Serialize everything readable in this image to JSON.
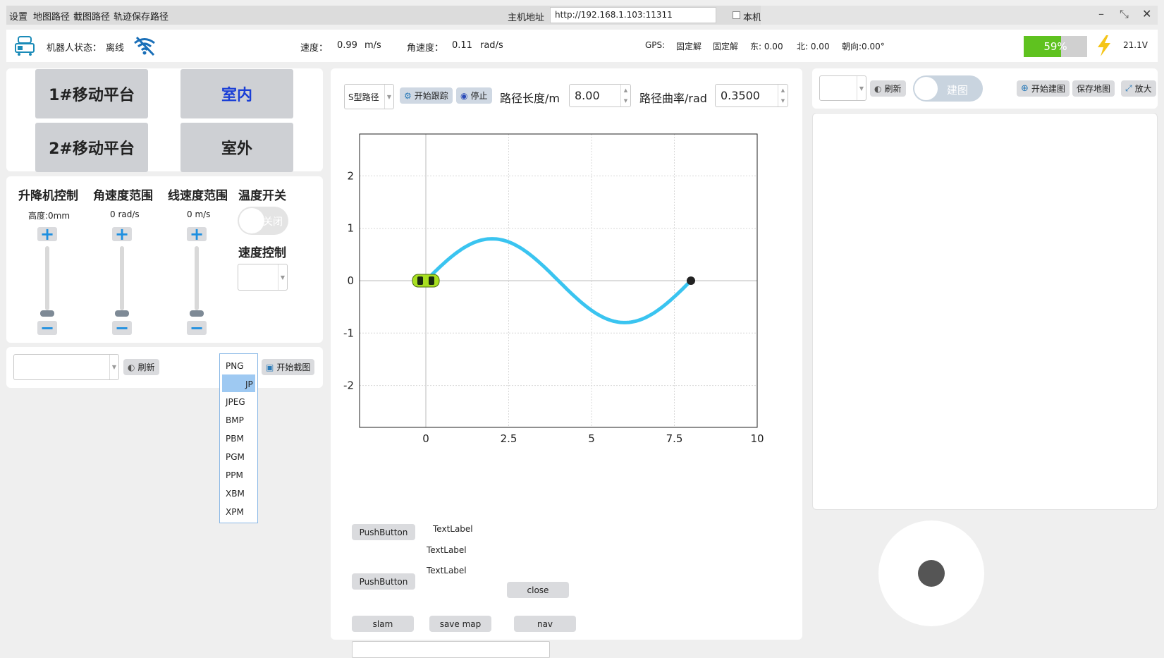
{
  "menu": {
    "items": [
      "设置",
      "地图路径",
      "截图路径",
      "轨迹保存路径"
    ],
    "host_label": "主机地址",
    "host_value": "http://192.168.1.103:11311",
    "local_label": "本机"
  },
  "status": {
    "robot_state_label": "机器人状态：",
    "robot_state": "离线",
    "speed_label": "速度：",
    "speed_value": "0.99",
    "speed_unit": "m/s",
    "ang_label": "角速度：",
    "ang_value": "0.11",
    "ang_unit": "rad/s",
    "gps_label": "GPS:",
    "gps_fix1": "固定解",
    "gps_fix2": "固定解",
    "east": "东: 0.00",
    "north": "北: 0.00",
    "heading": "朝向:0.00°",
    "battery": "59%",
    "battery_level": 0.59,
    "voltage": "21.1V"
  },
  "platform": {
    "btn1": "1#移动平台",
    "btn2": "室内",
    "btn3": "2#移动平台",
    "btn4": "室外"
  },
  "controls": {
    "lift_title": "升降机控制",
    "lift_value": "高度:0mm",
    "ang_title": "角速度范围",
    "ang_value": "0 rad/s",
    "lin_title": "线速度范围",
    "lin_value": "0 m/s",
    "temp_title": "温度开关",
    "temp_toggle": "关闭",
    "speed_ctrl_title": "速度控制"
  },
  "capture": {
    "refresh": "刷新",
    "start_capture": "开始截图",
    "formats": [
      "PNG",
      "JP",
      "JPEG",
      "BMP",
      "PBM",
      "PGM",
      "PPM",
      "XBM",
      "XPM"
    ],
    "selected_index": 1
  },
  "path": {
    "type": "S型路径",
    "start_track": "开始跟踪",
    "stop": "停止",
    "length_label": "路径长度/m",
    "length_value": "8.00",
    "curv_label": "路径曲率/rad",
    "curv_value": "0.3500"
  },
  "chart_data": {
    "type": "line",
    "xlim": [
      -2,
      10
    ],
    "ylim": [
      -2.8,
      2.8
    ],
    "x_ticks": [
      "0",
      "2.5",
      "5",
      "7.5",
      "10"
    ],
    "y_ticks": [
      "2",
      "1",
      "0",
      "-1",
      "-2"
    ],
    "grid": true,
    "amplitude": 0.8,
    "path_length": 8,
    "end_point": [
      8,
      0
    ],
    "color": "#3ac4f0"
  },
  "debug": {
    "push1": "PushButton",
    "push2": "PushButton",
    "text1": "TextLabel",
    "text2": "TextLabel",
    "text3": "TextLabel",
    "close": "close",
    "slam": "slam",
    "save_map": "save map",
    "nav": "nav"
  },
  "map": {
    "refresh": "刷新",
    "build_toggle": "建图",
    "start_build": "开始建图",
    "save_map": "保存地图",
    "zoom": "放大"
  },
  "window": {
    "minimize": "–",
    "restore": "⤡",
    "close": "✕"
  }
}
